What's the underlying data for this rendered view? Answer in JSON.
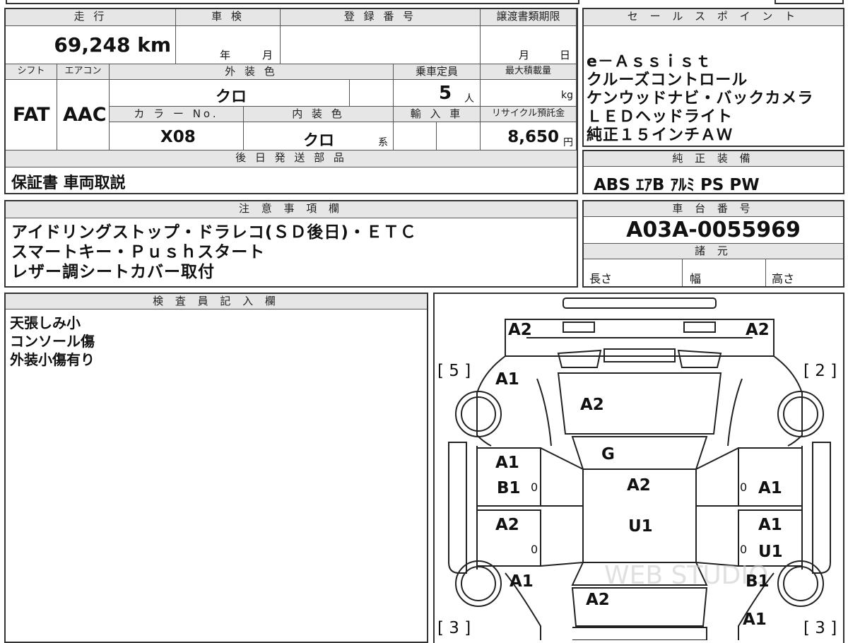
{
  "mileage": {
    "header": "走 行",
    "value": "69,248 km"
  },
  "shaken": {
    "header": "車 検",
    "year_unit": "年",
    "month_unit": "月"
  },
  "registration": {
    "header": "登 録 番 号",
    "value": ""
  },
  "transfer_deadline": {
    "header": "譲渡書類期限",
    "month_unit": "月",
    "day_unit": "日"
  },
  "sales_points": {
    "header": "セ ー ル ス ポ イ ン ト",
    "lines": [
      "e－Ａｓｓｉｓｔ",
      "クルーズコントロール",
      "ケンウッドナビ・バックカメラ",
      "ＬＥＤヘッドライト",
      "純正１５インチＡＷ"
    ]
  },
  "shift": {
    "header": "シフト",
    "value": "FAT"
  },
  "aircon": {
    "header": "エアコン",
    "value": "AAC"
  },
  "exterior_color": {
    "header": "外 装 色",
    "value": "クロ"
  },
  "capacity": {
    "header": "乗車定員",
    "value": "5",
    "unit": "人"
  },
  "max_load": {
    "header": "最大積載量",
    "unit": "kg"
  },
  "color_no": {
    "header": "カ ラ ー No.",
    "value": "X08"
  },
  "interior_color": {
    "header": "内 装 色",
    "value": "クロ",
    "suffix": "系"
  },
  "import": {
    "header": "輸 入 車"
  },
  "recycle_fee": {
    "header": "リサイクル預託金",
    "value": "8,650",
    "unit": "円"
  },
  "later_parts": {
    "header": "後 日 発 送 部 品",
    "value": "保証書 車両取説"
  },
  "genuine_equipment": {
    "header": "純 正 装 備",
    "value": "ABS ｴｱB ｱﾙﾐ PS PW"
  },
  "notes": {
    "header": "注 意 事 項 欄",
    "lines": [
      "アイドリングストップ・ドラレコ(ＳＤ後日)・ＥＴＣ",
      "スマートキー・Ｐｕｓｈスタート",
      "レザー調シートカバー取付"
    ]
  },
  "chassis": {
    "header": "車 台 番 号",
    "value": "A03A-0055969"
  },
  "specs": {
    "header": "諸 元",
    "length": "長さ",
    "width": "幅",
    "height": "高さ"
  },
  "inspector": {
    "header": "検 査 員 記 入 欄",
    "lines": [
      "天張しみ小",
      "コンソール傷",
      "外装小傷有り"
    ]
  },
  "diagram": {
    "marks": [
      {
        "id": "front-left",
        "text": "A2"
      },
      {
        "id": "front-right",
        "text": "A2"
      },
      {
        "id": "bracket-5",
        "text": "[ 5 ]"
      },
      {
        "id": "bracket-2",
        "text": "[ 2 ]"
      },
      {
        "id": "bracket-3-left",
        "text": "[ 3 ]"
      },
      {
        "id": "bracket-3-right",
        "text": "[ 3 ]"
      },
      {
        "id": "left-fender",
        "text": "A1"
      },
      {
        "id": "hood",
        "text": "A2"
      },
      {
        "id": "windshield",
        "text": "G"
      },
      {
        "id": "left-front-door-1",
        "text": "A1"
      },
      {
        "id": "left-front-door-2",
        "text": "B1"
      },
      {
        "id": "roof",
        "text": "A2"
      },
      {
        "id": "right-front-door",
        "text": "A1"
      },
      {
        "id": "left-rear-door",
        "text": "A2"
      },
      {
        "id": "roof-rear",
        "text": "U1"
      },
      {
        "id": "right-rear-door-1",
        "text": "A1"
      },
      {
        "id": "right-rear-door-2",
        "text": "U1"
      },
      {
        "id": "left-rear-fender",
        "text": "A1"
      },
      {
        "id": "right-rear-fender-1",
        "text": "B1"
      },
      {
        "id": "trunk",
        "text": "A2"
      },
      {
        "id": "right-rear-fender-2",
        "text": "A1"
      },
      {
        "id": "zero-1",
        "text": "0"
      },
      {
        "id": "zero-2",
        "text": "0"
      },
      {
        "id": "zero-3",
        "text": "0"
      },
      {
        "id": "zero-4",
        "text": "0"
      }
    ],
    "watermark": "WEB STUDIO"
  }
}
